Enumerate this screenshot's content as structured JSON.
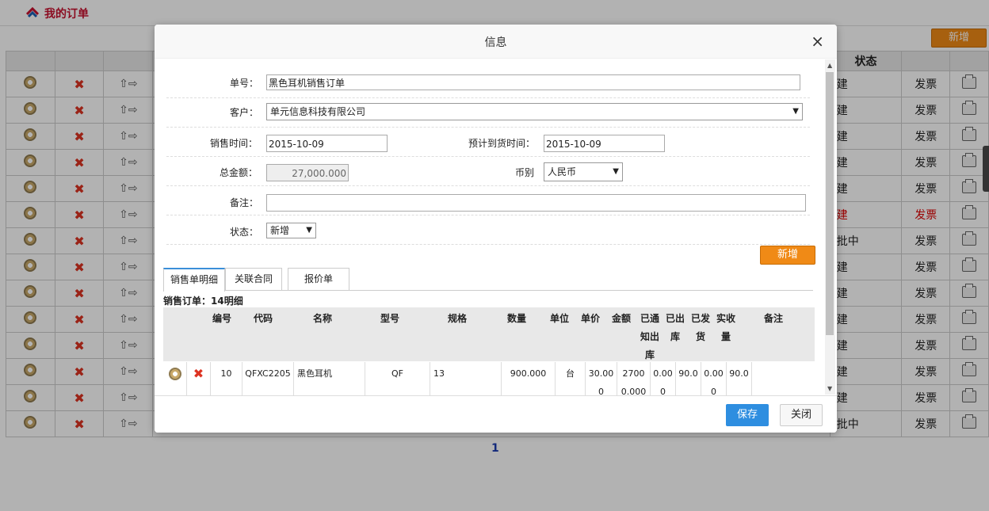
{
  "page": {
    "title": "我的订单",
    "add_label": "新增",
    "status_header": "状态",
    "pager": "1",
    "rows": [
      {
        "status": "建",
        "invoice": "发票",
        "invoice_red": false
      },
      {
        "status": "建",
        "invoice": "发票",
        "invoice_red": false
      },
      {
        "status": "建",
        "invoice": "发票",
        "invoice_red": false
      },
      {
        "status": "建",
        "invoice": "发票",
        "invoice_red": false
      },
      {
        "status": "建",
        "invoice": "发票",
        "invoice_red": false
      },
      {
        "status": "建",
        "invoice": "发票",
        "invoice_red": true
      },
      {
        "status": "批中",
        "invoice": "发票",
        "invoice_red": false
      },
      {
        "status": "建",
        "invoice": "发票",
        "invoice_red": false
      },
      {
        "status": "建",
        "invoice": "发票",
        "invoice_red": false
      },
      {
        "status": "建",
        "invoice": "发票",
        "invoice_red": false
      },
      {
        "status": "建",
        "invoice": "发票",
        "invoice_red": false
      },
      {
        "status": "建",
        "invoice": "发票",
        "invoice_red": false
      },
      {
        "status": "建",
        "invoice": "发票",
        "invoice_red": false
      },
      {
        "status": "批中",
        "invoice": "发票",
        "invoice_red": false
      }
    ]
  },
  "modal": {
    "title": "信息",
    "close_glyph": "×",
    "form": {
      "order_no_label": "单号：",
      "order_no_value": "黑色耳机销售订单",
      "customer_label": "客户：",
      "customer_value": "单元信息科技有限公司",
      "sale_time_label": "销售时间：",
      "sale_time_value": "2015-10-09",
      "eta_label": "预计到货时间：",
      "eta_value": "2015-10-09",
      "total_label": "总金额：",
      "total_value": "27,000.000",
      "currency_label": "币别",
      "currency_value": "人民币",
      "remark_label": "备注：",
      "remark_value": "",
      "status_label": "状态：",
      "status_value": "新增"
    },
    "add_label": "新增",
    "tabs": [
      {
        "label": "销售单明细"
      },
      {
        "label": "关联合同"
      },
      {
        "label": "报价单"
      }
    ],
    "sub_title": "销售订单：14明细",
    "detail": {
      "headers": {
        "no": "编号",
        "code": "代码",
        "name": "名称",
        "model": "型号",
        "spec": "规格",
        "qty": "数量",
        "unit": "单位",
        "price": "单价",
        "amount": "金额",
        "notified": "已通知出库",
        "out": "已出库",
        "shipped": "已发货",
        "received": "实收量",
        "remark": "备注"
      },
      "row": {
        "no": "10",
        "code": "QFXC2205",
        "name": "黑色耳机",
        "model": "QF",
        "spec": "13",
        "qty": "900.000",
        "unit": "台",
        "price": "30.000",
        "amount": "27000.000",
        "notified": "0.000",
        "out": "90.0",
        "shipped": "0.000",
        "received": "90.0",
        "remark": ""
      }
    },
    "save_label": "保存",
    "close_label": "关闭"
  }
}
